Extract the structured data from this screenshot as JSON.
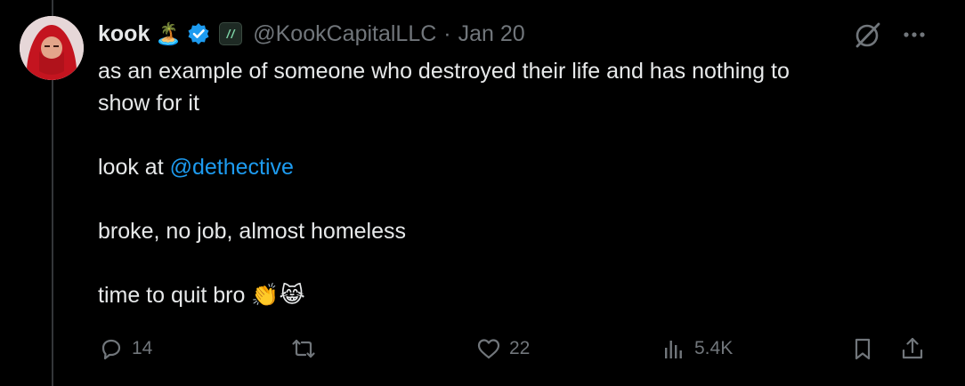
{
  "tweet": {
    "display_name": "kook",
    "name_emoji": "🏝️",
    "handle": "@KookCapitalLLC",
    "separator": "·",
    "date": "Jan 20",
    "lines": {
      "l1": "as an example of someone who destroyed their life and has nothing to",
      "l2": "show for it",
      "l3_prefix": "look at ",
      "l3_mention": "@dethective",
      "l4": "broke, no job, almost homeless",
      "l5": "time to quit bro",
      "l5_emoji": "👏😹"
    }
  },
  "actions": {
    "reply_count": "14",
    "like_count": "22",
    "views_count": "5.4K"
  },
  "icons": [
    "reply-icon",
    "retweet-icon",
    "like-icon",
    "views-icon",
    "bookmark-icon",
    "share-icon",
    "grok-icon",
    "more-icon",
    "verified-badge-icon",
    "affiliate-badge-icon"
  ],
  "colors": {
    "background": "#000000",
    "text": "#e7e9ea",
    "muted": "#71767b",
    "accent": "#1d9bf0"
  }
}
